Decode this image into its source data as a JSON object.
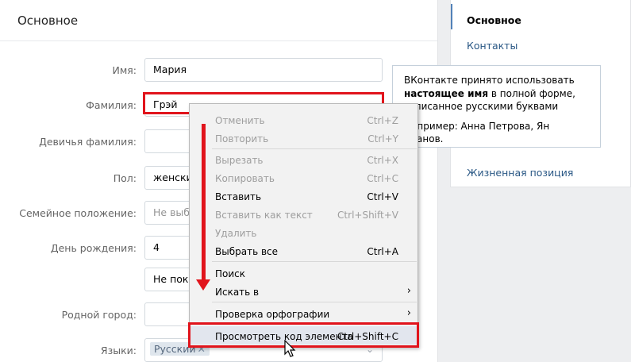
{
  "main": {
    "title": "Основное",
    "fields": [
      {
        "label": "Имя:",
        "value": "Мария"
      },
      {
        "label": "Фамилия:",
        "value": "Грэй"
      },
      {
        "label": "Девичья фамилия:",
        "value": ""
      },
      {
        "label": "Пол:",
        "value": "женски"
      },
      {
        "label": "Семейное положение:",
        "value": "Не выбр"
      },
      {
        "label": "День рождения:",
        "value": "4"
      },
      {
        "label": "",
        "value": "Не пока"
      },
      {
        "label": "Родной город:",
        "value": ""
      },
      {
        "label": "Языки:",
        "value": "Русский",
        "tag_x": "✕"
      }
    ]
  },
  "sidebar": {
    "items": [
      {
        "label": "Основное"
      },
      {
        "label": "Контакты"
      },
      {
        "label": "Жизненная позиция"
      }
    ]
  },
  "tooltip": {
    "line1": "ВКонтакте принято использовать",
    "bold": "настоящее имя",
    "line2": " в полной форме,",
    "line3": "записанное русскими буквами",
    "example": "Например: Анна Петрова, Ян Иванов."
  },
  "context_menu": {
    "items": [
      {
        "label": "Отменить",
        "shortcut": "Ctrl+Z",
        "disabled": true
      },
      {
        "label": "Повторить",
        "shortcut": "Ctrl+Y",
        "disabled": true
      },
      {
        "label": "Вырезать",
        "shortcut": "Ctrl+X",
        "disabled": true
      },
      {
        "label": "Копировать",
        "shortcut": "Ctrl+C",
        "disabled": true
      },
      {
        "label": "Вставить",
        "shortcut": "Ctrl+V",
        "disabled": false
      },
      {
        "label": "Вставить как текст",
        "shortcut": "Ctrl+Shift+V",
        "disabled": true
      },
      {
        "label": "Удалить",
        "shortcut": "",
        "disabled": true
      },
      {
        "label": "Выбрать все",
        "shortcut": "Ctrl+A",
        "disabled": false
      },
      {
        "label": "Поиск",
        "shortcut": "",
        "disabled": false
      },
      {
        "label": "Искать в",
        "shortcut": "",
        "disabled": false,
        "submenu": "›"
      },
      {
        "label": "Проверка орфографии",
        "shortcut": "",
        "disabled": false,
        "submenu": "›"
      },
      {
        "label": "Просмотреть код элемента",
        "shortcut": "Ctrl+Shift+C",
        "disabled": false
      }
    ]
  },
  "icons": {
    "chevron": "chevron-down-icon",
    "submenu": "chevron-right-icon",
    "cursor": "mouse-pointer-icon"
  },
  "colors": {
    "accent": "#5181b8",
    "link": "#2a5885",
    "highlight": "#e1141c"
  }
}
